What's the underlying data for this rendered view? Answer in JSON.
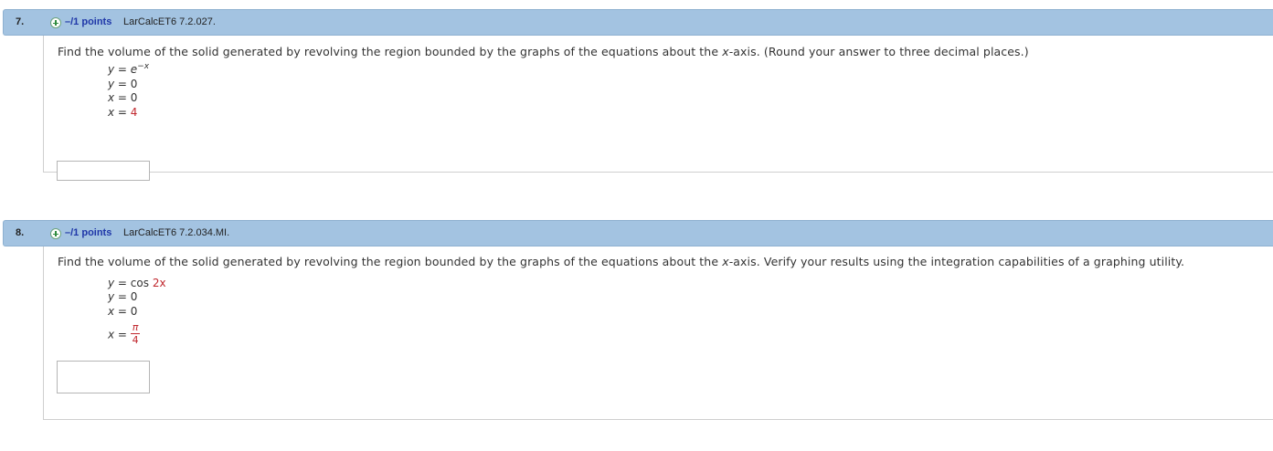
{
  "questions": [
    {
      "number": "7.",
      "points": "–/1 points",
      "source": "LarCalcET6 7.2.027.",
      "prompt_parts": [
        "Find the volume of the solid generated by revolving the region bounded by the graphs of the equations about the ",
        "x",
        "-axis. (Round your answer to three decimal places.)"
      ],
      "equations": [
        {
          "lhs": "y",
          "eq": " = ",
          "rhs": "e",
          "sup": "−x"
        },
        {
          "lhs": "y",
          "eq": " = ",
          "rhs": "0"
        },
        {
          "lhs": "x",
          "eq": " = ",
          "rhs": "0"
        },
        {
          "lhs": "x",
          "eq": " = ",
          "rhs": "4"
        }
      ],
      "answer_value": ""
    },
    {
      "number": "8.",
      "points": "–/1 points",
      "source": "LarCalcET6 7.2.034.MI.",
      "prompt_parts": [
        "Find the volume of the solid generated by revolving the region bounded by the graphs of the equations about the ",
        "x",
        "-axis. Verify your results using the integration capabilities of a graphing utility."
      ],
      "equations": [
        {
          "lhs": "y",
          "eq": " = ",
          "rhs": "cos ",
          "rhs2": "2x"
        },
        {
          "lhs": "y",
          "eq": " = ",
          "rhs": "0"
        },
        {
          "lhs": "x",
          "eq": " = ",
          "rhs": "0"
        },
        {
          "lhs": "x",
          "eq": " = ",
          "num": "π",
          "den": "4"
        }
      ],
      "answer_value": ""
    }
  ],
  "colors": {
    "header_bg": "#a3c3e1",
    "points_text": "#1f37a8",
    "highlight_red": "#c0272d",
    "plus_green": "#2e8b3e"
  },
  "icons": {
    "expand": "plus-circle-icon"
  }
}
